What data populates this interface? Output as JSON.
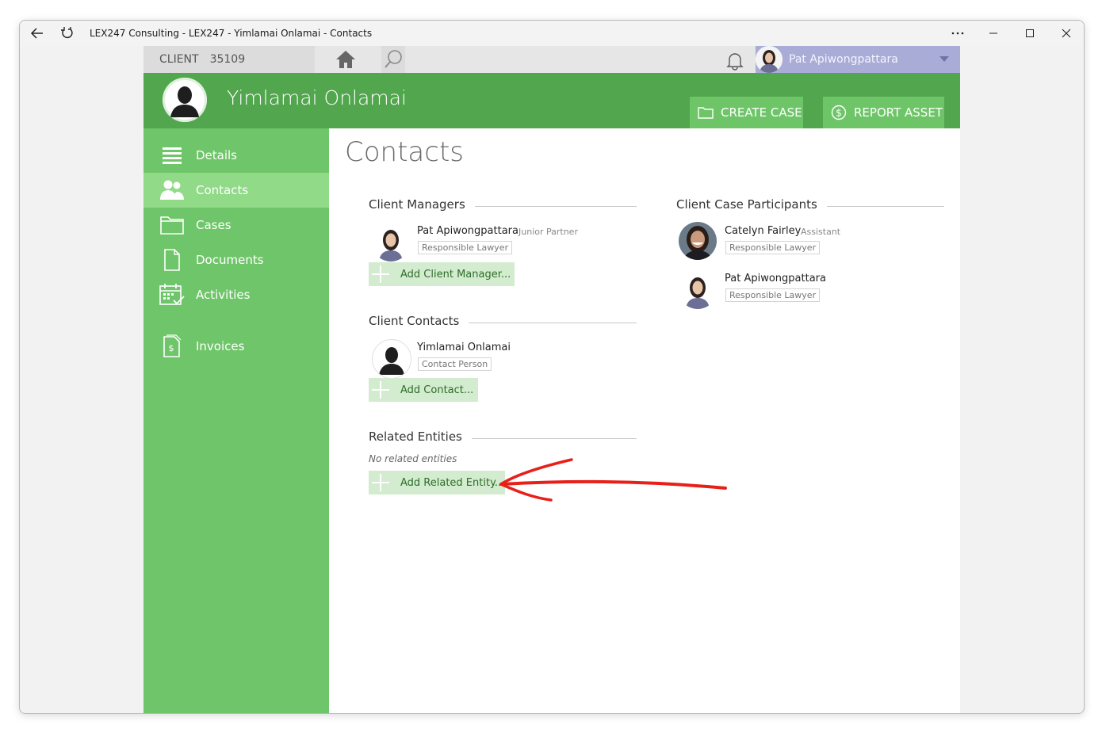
{
  "window": {
    "title": "LEX247 Consulting - LEX247 - Yimlamai Onlamai - Contacts"
  },
  "topbar": {
    "client_label": "CLIENT",
    "client_id": "35109",
    "user_name": "Pat Apiwongpattara"
  },
  "header": {
    "client_name": "Yimlamai Onlamai",
    "create_case_label": "CREATE CASE",
    "report_asset_label": "REPORT ASSET"
  },
  "sidebar": {
    "items": [
      {
        "label": "Details",
        "icon": "list-icon"
      },
      {
        "label": "Contacts",
        "icon": "people-icon",
        "active": true
      },
      {
        "label": "Cases",
        "icon": "folder-icon"
      },
      {
        "label": "Documents",
        "icon": "document-icon"
      },
      {
        "label": "Activities",
        "icon": "calendar-icon"
      },
      {
        "label": "Invoices",
        "icon": "invoice-icon"
      }
    ]
  },
  "content": {
    "page_title": "Contacts",
    "client_managers": {
      "title": "Client Managers",
      "people": [
        {
          "name": "Pat Apiwongpattara",
          "role": "Junior Partner",
          "tag": "Responsible Lawyer"
        }
      ],
      "add_label": "Add Client Manager..."
    },
    "client_contacts": {
      "title": "Client Contacts",
      "people": [
        {
          "name": "Yimlamai Onlamai",
          "tag": "Contact Person"
        }
      ],
      "add_label": "Add Contact..."
    },
    "related_entities": {
      "title": "Related Entities",
      "empty_text": "No related entities",
      "add_label": "Add Related Entity..."
    },
    "case_participants": {
      "title": "Client Case Participants",
      "people": [
        {
          "name": "Catelyn Fairley",
          "role": "Assistant",
          "tag": "Responsible Lawyer"
        },
        {
          "name": "Pat Apiwongpattara",
          "tag": "Responsible Lawyer"
        }
      ]
    }
  },
  "colors": {
    "header_green": "#52a64e",
    "sidebar_green": "#6fc569",
    "active_nav": "#90da88",
    "add_button": "#d3ebce",
    "user_box": "#a9acd6",
    "annotation_arrow": "#e8201a"
  }
}
